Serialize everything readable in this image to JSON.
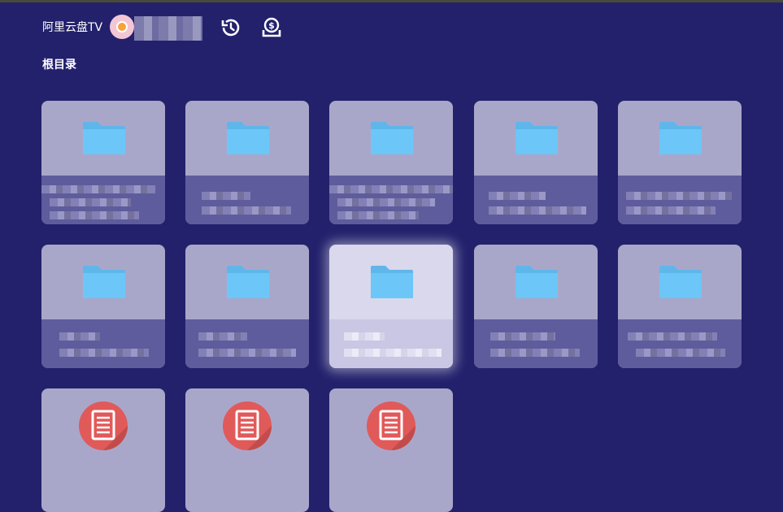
{
  "header": {
    "app_title": "阿里云盘TV",
    "username": "",
    "history_icon": "history-icon",
    "cloud_icon": "cloud-storage-icon"
  },
  "breadcrumb": "根目录",
  "colors": {
    "background": "#23216c",
    "card": "#a9a7c9",
    "card_focused": "#d9d8ec",
    "folder": "#6cc6f7",
    "file_icon": "#e05a5a"
  },
  "grid": {
    "items": [
      {
        "type": "folder",
        "name": ""
      },
      {
        "type": "folder",
        "name": ""
      },
      {
        "type": "folder",
        "name": ""
      },
      {
        "type": "folder",
        "name": ""
      },
      {
        "type": "folder",
        "name": ""
      },
      {
        "type": "folder",
        "name": ""
      },
      {
        "type": "folder",
        "name": ""
      },
      {
        "type": "folder",
        "name": "",
        "focused": true
      },
      {
        "type": "folder",
        "name": ""
      },
      {
        "type": "folder",
        "name": ""
      },
      {
        "type": "document",
        "name": ""
      },
      {
        "type": "document",
        "name": ""
      },
      {
        "type": "document",
        "name": ""
      }
    ]
  }
}
